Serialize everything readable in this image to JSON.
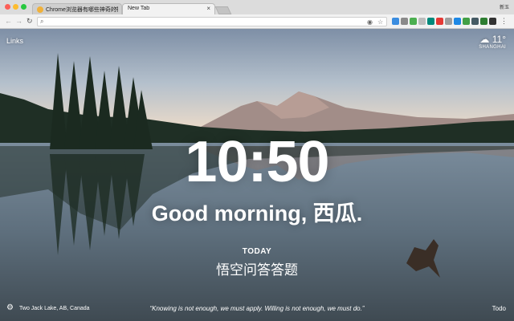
{
  "browser": {
    "tabs": [
      {
        "title": "Chrome浏览器有哪些神奇的插件",
        "close": "×"
      },
      {
        "title": "New Tab",
        "close": "×"
      }
    ],
    "user": "新玉",
    "omnibox": {
      "value": "",
      "placeholder": ""
    },
    "extension_colors": [
      "#3b8de0",
      "#8a8a8a",
      "#4caf50",
      "#bdbdbd",
      "#00897b",
      "#e53935",
      "#9e9e9e",
      "#1e88e5",
      "#43a047",
      "#455a64",
      "#2e7d32",
      "#333333"
    ]
  },
  "page": {
    "links_label": "Links",
    "weather": {
      "temp": "11°",
      "city": "SHANGHAI"
    },
    "time": "10:50",
    "greeting": "Good morning, 西瓜.",
    "focus": {
      "label": "TODAY",
      "text": "悟空问答答题"
    },
    "location": "Two Jack Lake, AB, Canada",
    "quote": "“Knowing is not enough, we must apply. Willing is not enough, we must do.”",
    "todo": "Todo"
  },
  "icons": [
    "back-icon",
    "forward-icon",
    "reload-icon",
    "search-icon",
    "star-icon",
    "settings-gear-icon",
    "weather-cloud-icon",
    "menu-icon"
  ]
}
